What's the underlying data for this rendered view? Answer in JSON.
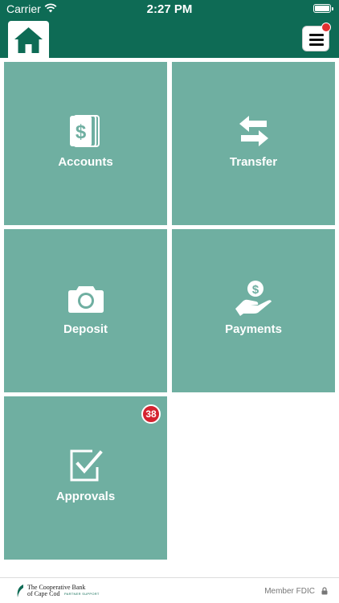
{
  "status_bar": {
    "carrier": "Carrier",
    "time": "2:27 PM"
  },
  "nav": {
    "home_icon": "home-icon",
    "menu_icon": "hamburger-menu-icon",
    "menu_has_notification": true
  },
  "tiles": [
    {
      "label": "Accounts",
      "icon": "dollar-bills-icon"
    },
    {
      "label": "Transfer",
      "icon": "transfer-arrows-icon"
    },
    {
      "label": "Deposit",
      "icon": "camera-icon"
    },
    {
      "label": "Payments",
      "icon": "hand-coin-icon"
    },
    {
      "label": "Approvals",
      "icon": "checkbox-icon",
      "badge": "38"
    }
  ],
  "footer": {
    "bank_name_line1": "The Cooperative Bank",
    "bank_name_line2": "of Cape Cod",
    "tagline": "PARTNER SUPPORT",
    "member": "Member FDIC"
  },
  "colors": {
    "brand_green": "#0e6b55",
    "tile_green": "#6fafa1",
    "badge_red": "#d4232f"
  }
}
